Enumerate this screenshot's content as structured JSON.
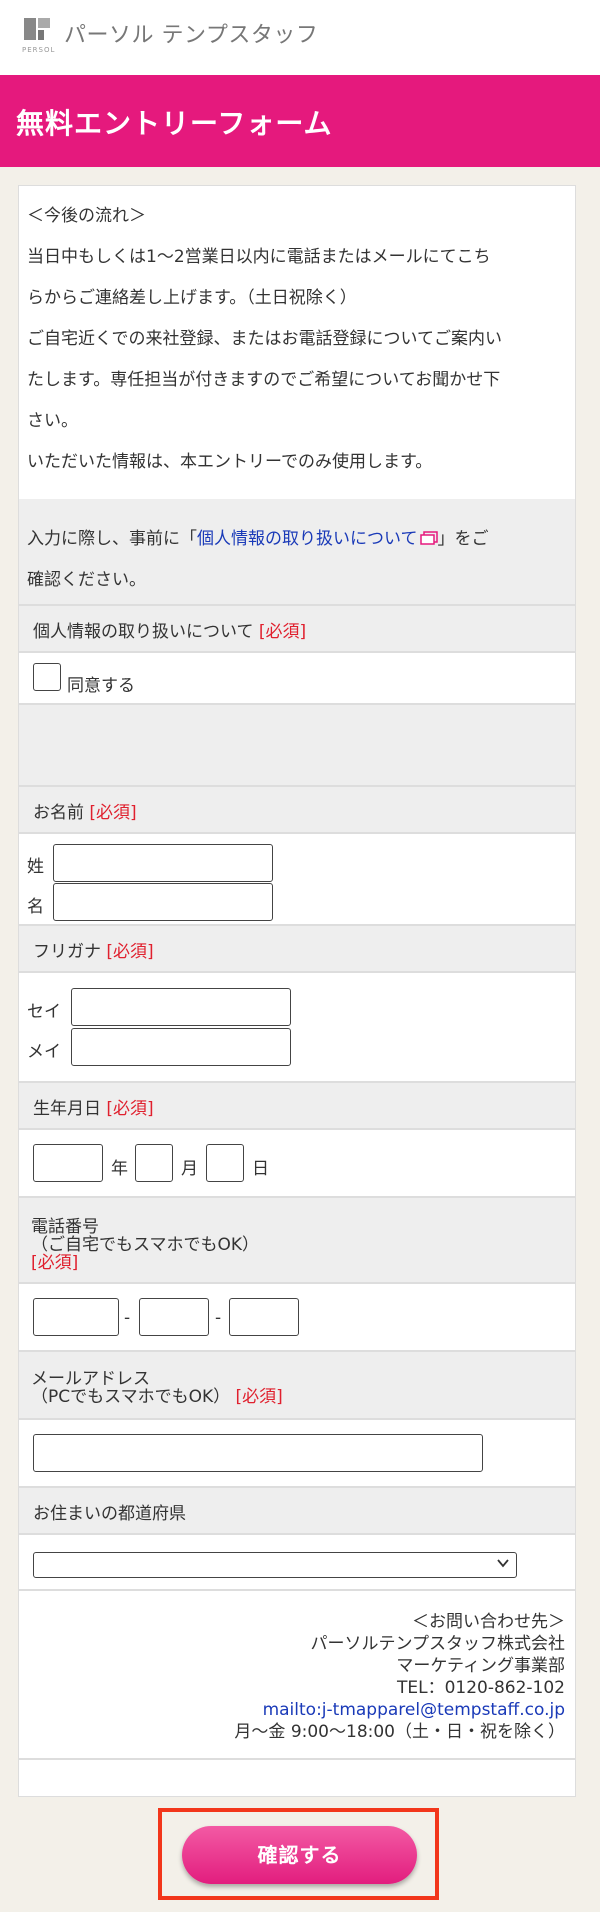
{
  "header": {
    "logo_text": "PERSOL",
    "brand": "パーソル テンプスタッフ"
  },
  "title": "無料エントリーフォーム",
  "intro": {
    "lines": [
      "＜今後の流れ＞",
      "当日中もしくは1〜2営業日以内に電話またはメールにてこち",
      "らからご連絡差し上げます。（土日祝除く）",
      "ご自宅近くでの来社登録、またはお電話登録についてご案内い",
      "たします。専任担当が付きますのでご希望についてお聞かせ下",
      "さい。",
      "いただいた情報は、本エントリーでのみ使用します。"
    ]
  },
  "privacy_notice": {
    "prefix": "入力に際し、事前に「",
    "link": "個人情報の取り扱いについて",
    "suffix": "」をご",
    "line2": "確認ください。"
  },
  "privacy": {
    "label": "個人情報の取り扱いについて",
    "required": "[必須]",
    "checkbox_label": "同意する"
  },
  "name": {
    "label": "お名前",
    "required": "[必須]",
    "sei": "姓",
    "mei": "名"
  },
  "furigana": {
    "label": "フリガナ",
    "required": "[必須]",
    "sei": "セイ",
    "mei": "メイ"
  },
  "birth": {
    "label": "生年月日",
    "required": "[必須]",
    "year": "年",
    "month": "月",
    "day": "日"
  },
  "phone": {
    "label": "電話番号",
    "note": "（ご自宅でもスマホでもOK）",
    "required": "[必須]",
    "sep": "-"
  },
  "email": {
    "label": "メールアドレス",
    "note": "（PCでもスマホでもOK）",
    "required": "[必須]"
  },
  "prefecture": {
    "label": "お住まいの都道府県"
  },
  "contact": {
    "heading": "＜お問い合わせ先＞",
    "company": "パーソルテンプスタッフ株式会社",
    "dept": "マーケティング事業部",
    "tel": "TEL：0120-862-102",
    "mail": "mailto:j-tmapparel@tempstaff.co.jp",
    "hours": "月〜金 9:00〜18:00（土・日・祝を除く）"
  },
  "confirm_button": "確認する",
  "colors": {
    "brand_pink": "#e5197d",
    "required_red": "#e0202e",
    "link_blue": "#1a3ab8",
    "highlight": "#f2361b"
  }
}
